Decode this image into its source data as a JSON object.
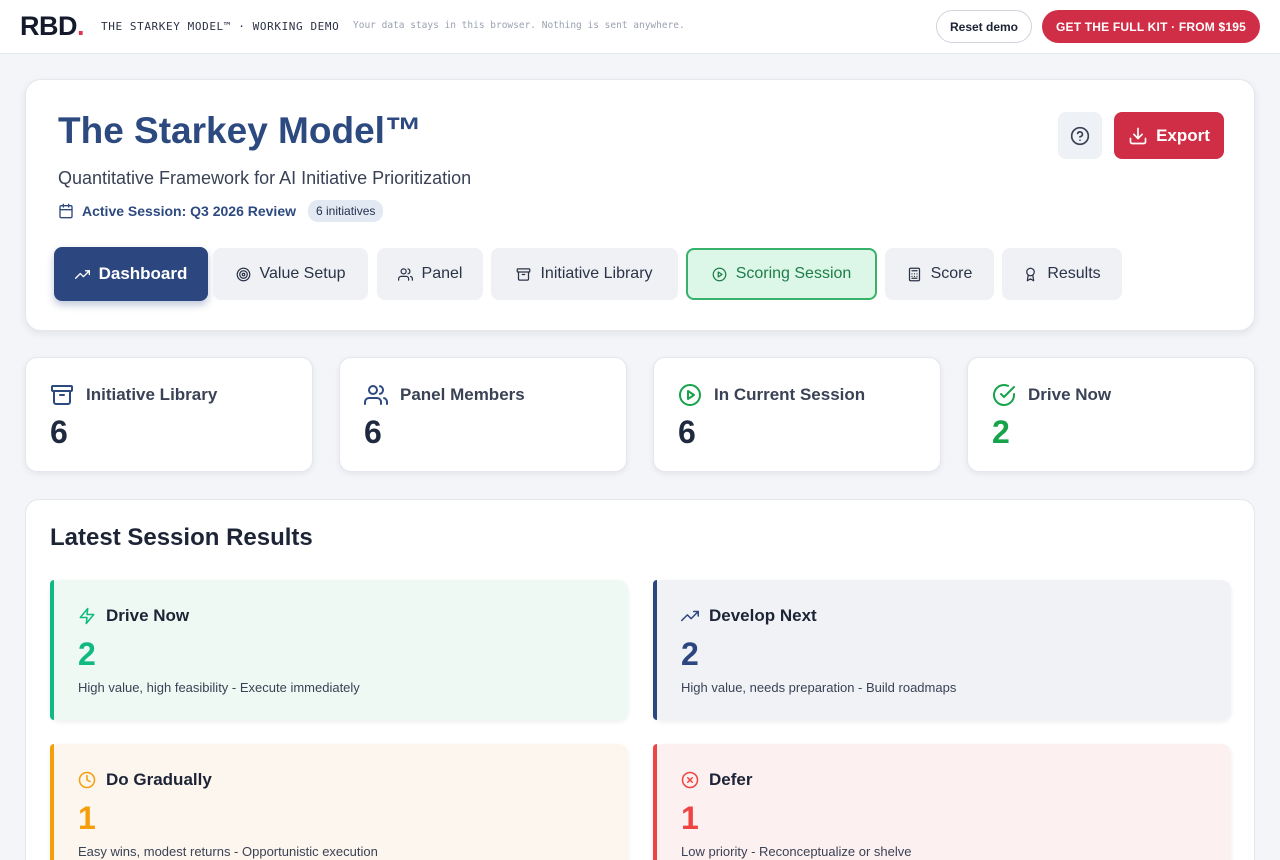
{
  "topbar": {
    "logo": "RBD",
    "logo_dot": ".",
    "product": "THE STARKEY MODEL™ · WORKING DEMO",
    "privacy": "Your data stays in this browser. Nothing is sent anywhere.",
    "reset_label": "Reset demo",
    "kit_label": "GET THE FULL KIT · FROM $195"
  },
  "header": {
    "title": "The Starkey Model™",
    "subtitle": "Quantitative Framework for AI Initiative Prioritization",
    "session_label": "Active Session: Q3 2026 Review",
    "session_badge": "6 initiatives",
    "export_label": "Export"
  },
  "tabs": [
    {
      "label": "Dashboard",
      "icon": "trending-up-icon",
      "state": "active"
    },
    {
      "label": "Value Setup",
      "icon": "target-icon"
    },
    {
      "label": "Panel",
      "icon": "users-icon"
    },
    {
      "label": "Initiative Library",
      "icon": "archive-icon"
    },
    {
      "label": "Scoring Session",
      "icon": "play-circle-icon",
      "state": "highlighted"
    },
    {
      "label": "Score",
      "icon": "calculator-icon"
    },
    {
      "label": "Results",
      "icon": "award-icon"
    }
  ],
  "stats": [
    {
      "label": "Initiative Library",
      "value": "6",
      "icon": "archive-icon"
    },
    {
      "label": "Panel Members",
      "value": "6",
      "icon": "users-icon"
    },
    {
      "label": "In Current Session",
      "value": "6",
      "icon": "play-circle-icon"
    },
    {
      "label": "Drive Now",
      "value": "2",
      "icon": "check-circle-icon",
      "color": "#16a34a"
    }
  ],
  "results": {
    "title": "Latest Session Results",
    "categories": [
      {
        "label": "Drive Now",
        "value": "2",
        "desc": "High value, high feasibility - Execute immediately",
        "accent": "#10b981",
        "bg": "#eef9f4",
        "icon": "zap-icon"
      },
      {
        "label": "Develop Next",
        "value": "2",
        "desc": "High value, needs preparation - Build roadmaps",
        "accent": "#2c4680",
        "bg": "#f0f2f6",
        "icon": "trending-up-icon"
      },
      {
        "label": "Do Gradually",
        "value": "1",
        "desc": "Easy wins, modest returns - Opportunistic execution",
        "accent": "#f59e0b",
        "bg": "#fdf6ee",
        "icon": "clock-icon"
      },
      {
        "label": "Defer",
        "value": "1",
        "desc": "Low priority - Reconceptualize or shelve",
        "accent": "#ef4444",
        "bg": "#fdf0f0",
        "icon": "x-circle-icon"
      }
    ]
  }
}
